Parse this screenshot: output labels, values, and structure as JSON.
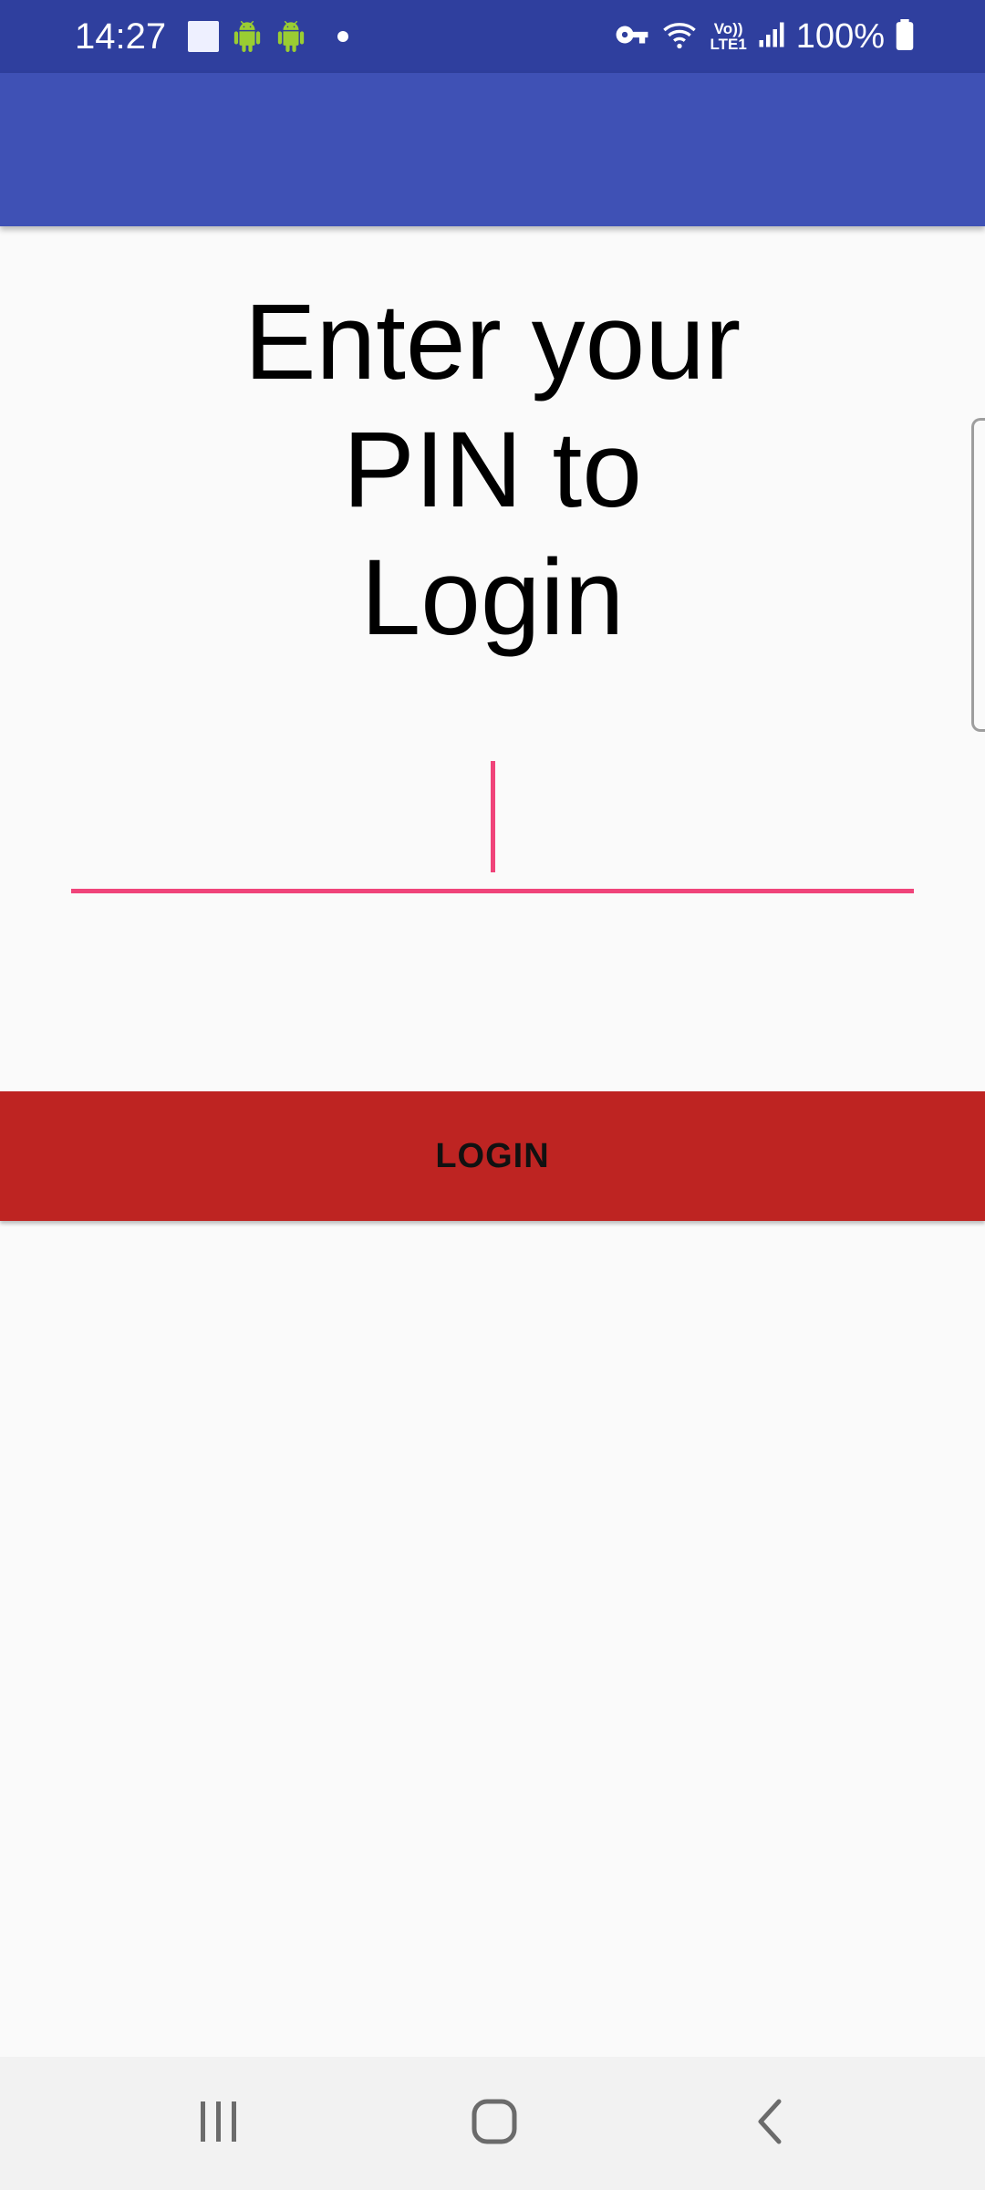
{
  "status_bar": {
    "time": "14:27",
    "battery": "100%",
    "volte_line1": "Vo))",
    "volte_line2": "LTE1"
  },
  "main": {
    "title_lines": [
      "Enter your",
      "PIN to",
      "Login"
    ],
    "pin_value": "",
    "login_label": "LOGIN"
  },
  "colors": {
    "status_bar": "#2f3f9e",
    "app_bar": "#3f51b5",
    "accent": "#f0447a",
    "button": "#be2422"
  },
  "nav_bar": {
    "icons": [
      "recent-apps-icon",
      "home-icon",
      "back-icon"
    ]
  }
}
